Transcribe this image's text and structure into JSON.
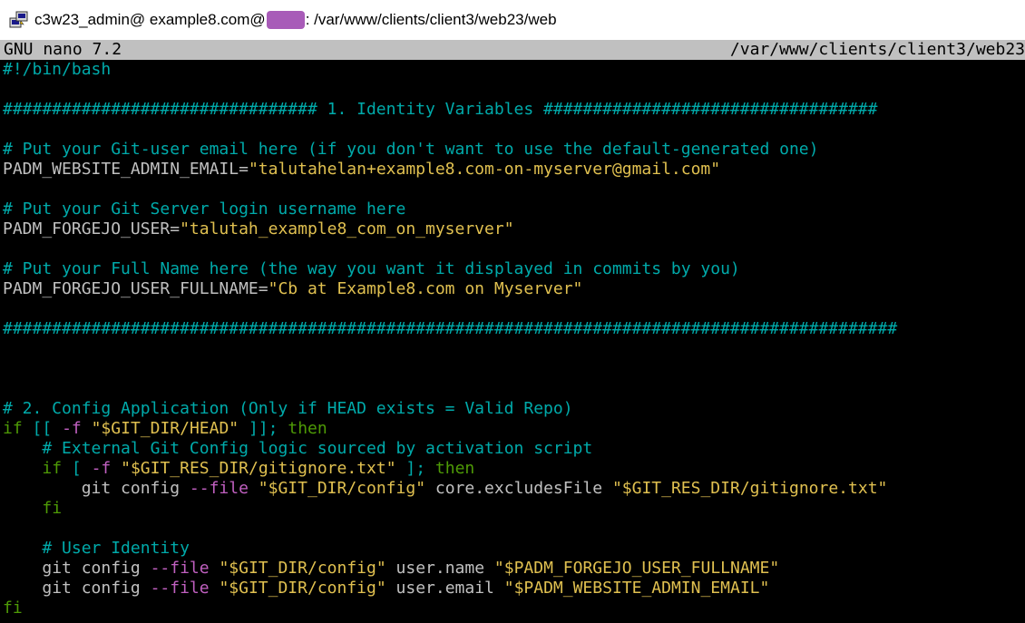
{
  "window": {
    "title_prefix": "c3w23_admin@ example8.com@",
    "title_suffix": ": /var/www/clients/client3/web23/web"
  },
  "nano": {
    "version": "GNU nano 7.2",
    "filename": "/var/www/clients/client3/web23"
  },
  "lines": [
    {
      "row": 0,
      "spans": [
        {
          "c": "d",
          "t": "#!/bin/bash"
        }
      ]
    },
    {
      "row": 2,
      "spans": [
        {
          "c": "d",
          "t": "################################ 1. Identity Variables ##################################"
        }
      ]
    },
    {
      "row": 4,
      "spans": [
        {
          "c": "d",
          "t": "# Put your Git-user email here (if you don't want to use the default-generated one)"
        }
      ]
    },
    {
      "row": 5,
      "spans": [
        {
          "c": "v",
          "t": "PADM_WEBSITE_ADMIN_EMAIL="
        },
        {
          "c": "s",
          "t": "\"talutahelan+example8.com-on-myserver@gmail.com\""
        }
      ]
    },
    {
      "row": 7,
      "spans": [
        {
          "c": "d",
          "t": "# Put your Git Server login username here"
        }
      ]
    },
    {
      "row": 8,
      "spans": [
        {
          "c": "v",
          "t": "PADM_FORGEJO_USER="
        },
        {
          "c": "s",
          "t": "\"talutah_example8_com_on_myserver\""
        }
      ]
    },
    {
      "row": 10,
      "spans": [
        {
          "c": "d",
          "t": "# Put your Full Name here (the way you want it displayed in commits by you)"
        }
      ]
    },
    {
      "row": 11,
      "spans": [
        {
          "c": "v",
          "t": "PADM_FORGEJO_USER_FULLNAME="
        },
        {
          "c": "s",
          "t": "\"Cb at Example8.com on Myserver\""
        }
      ]
    },
    {
      "row": 13,
      "spans": [
        {
          "c": "d",
          "t": "###########################################################################################"
        }
      ]
    },
    {
      "row": 17,
      "spans": [
        {
          "c": "d",
          "t": "# 2. Config Application (Only if HEAD exists = Valid Repo)"
        }
      ]
    },
    {
      "row": 18,
      "spans": [
        {
          "c": "k",
          "t": "if"
        },
        {
          "c": "w",
          "t": " "
        },
        {
          "c": "b",
          "t": "[["
        },
        {
          "c": "w",
          "t": " "
        },
        {
          "c": "o",
          "t": "-f"
        },
        {
          "c": "w",
          "t": " "
        },
        {
          "c": "s",
          "t": "\"$GIT_DIR/HEAD\""
        },
        {
          "c": "w",
          "t": " "
        },
        {
          "c": "b",
          "t": "]];"
        },
        {
          "c": "w",
          "t": " "
        },
        {
          "c": "k",
          "t": "then"
        }
      ]
    },
    {
      "row": 19,
      "spans": [
        {
          "c": "w",
          "t": "    "
        },
        {
          "c": "d",
          "t": "# External Git Config logic sourced by activation script"
        }
      ]
    },
    {
      "row": 20,
      "spans": [
        {
          "c": "w",
          "t": "    "
        },
        {
          "c": "k",
          "t": "if"
        },
        {
          "c": "w",
          "t": " "
        },
        {
          "c": "b",
          "t": "["
        },
        {
          "c": "w",
          "t": " "
        },
        {
          "c": "o",
          "t": "-f"
        },
        {
          "c": "w",
          "t": " "
        },
        {
          "c": "s",
          "t": "\"$GIT_RES_DIR/gitignore.txt\""
        },
        {
          "c": "w",
          "t": " "
        },
        {
          "c": "b",
          "t": "];"
        },
        {
          "c": "w",
          "t": " "
        },
        {
          "c": "k",
          "t": "then"
        }
      ]
    },
    {
      "row": 21,
      "spans": [
        {
          "c": "w",
          "t": "        "
        },
        {
          "c": "t",
          "t": "git config "
        },
        {
          "c": "o",
          "t": "--file"
        },
        {
          "c": "w",
          "t": " "
        },
        {
          "c": "s",
          "t": "\"$GIT_DIR/config\""
        },
        {
          "c": "t",
          "t": " core.excludesFile "
        },
        {
          "c": "s",
          "t": "\"$GIT_RES_DIR/gitignore.txt\""
        }
      ]
    },
    {
      "row": 22,
      "spans": [
        {
          "c": "w",
          "t": "    "
        },
        {
          "c": "k",
          "t": "fi"
        }
      ]
    },
    {
      "row": 24,
      "spans": [
        {
          "c": "w",
          "t": "    "
        },
        {
          "c": "d",
          "t": "# User Identity"
        }
      ]
    },
    {
      "row": 25,
      "spans": [
        {
          "c": "w",
          "t": "    "
        },
        {
          "c": "t",
          "t": "git config "
        },
        {
          "c": "o",
          "t": "--file"
        },
        {
          "c": "w",
          "t": " "
        },
        {
          "c": "s",
          "t": "\"$GIT_DIR/config\""
        },
        {
          "c": "t",
          "t": " user.name "
        },
        {
          "c": "s",
          "t": "\"$PADM_FORGEJO_USER_FULLNAME\""
        }
      ]
    },
    {
      "row": 26,
      "spans": [
        {
          "c": "w",
          "t": "    "
        },
        {
          "c": "t",
          "t": "git config "
        },
        {
          "c": "o",
          "t": "--file"
        },
        {
          "c": "w",
          "t": " "
        },
        {
          "c": "s",
          "t": "\"$GIT_DIR/config\""
        },
        {
          "c": "t",
          "t": " user.email "
        },
        {
          "c": "s",
          "t": "\"$PADM_WEBSITE_ADMIN_EMAIL\""
        }
      ]
    },
    {
      "row": 27,
      "spans": [
        {
          "c": "k",
          "t": "fi"
        }
      ]
    }
  ],
  "colors": {
    "terminal_bg": "#000000",
    "comment": "#00aaaa",
    "string": "#e0c050",
    "keyword": "#4e9a06",
    "option": "#c060c0",
    "plain": "#c0c0c0",
    "statusbar_bg": "#c0c0c0",
    "redaction": "#a85bb8"
  },
  "icons": {
    "app": "putty-terminal-icon"
  }
}
